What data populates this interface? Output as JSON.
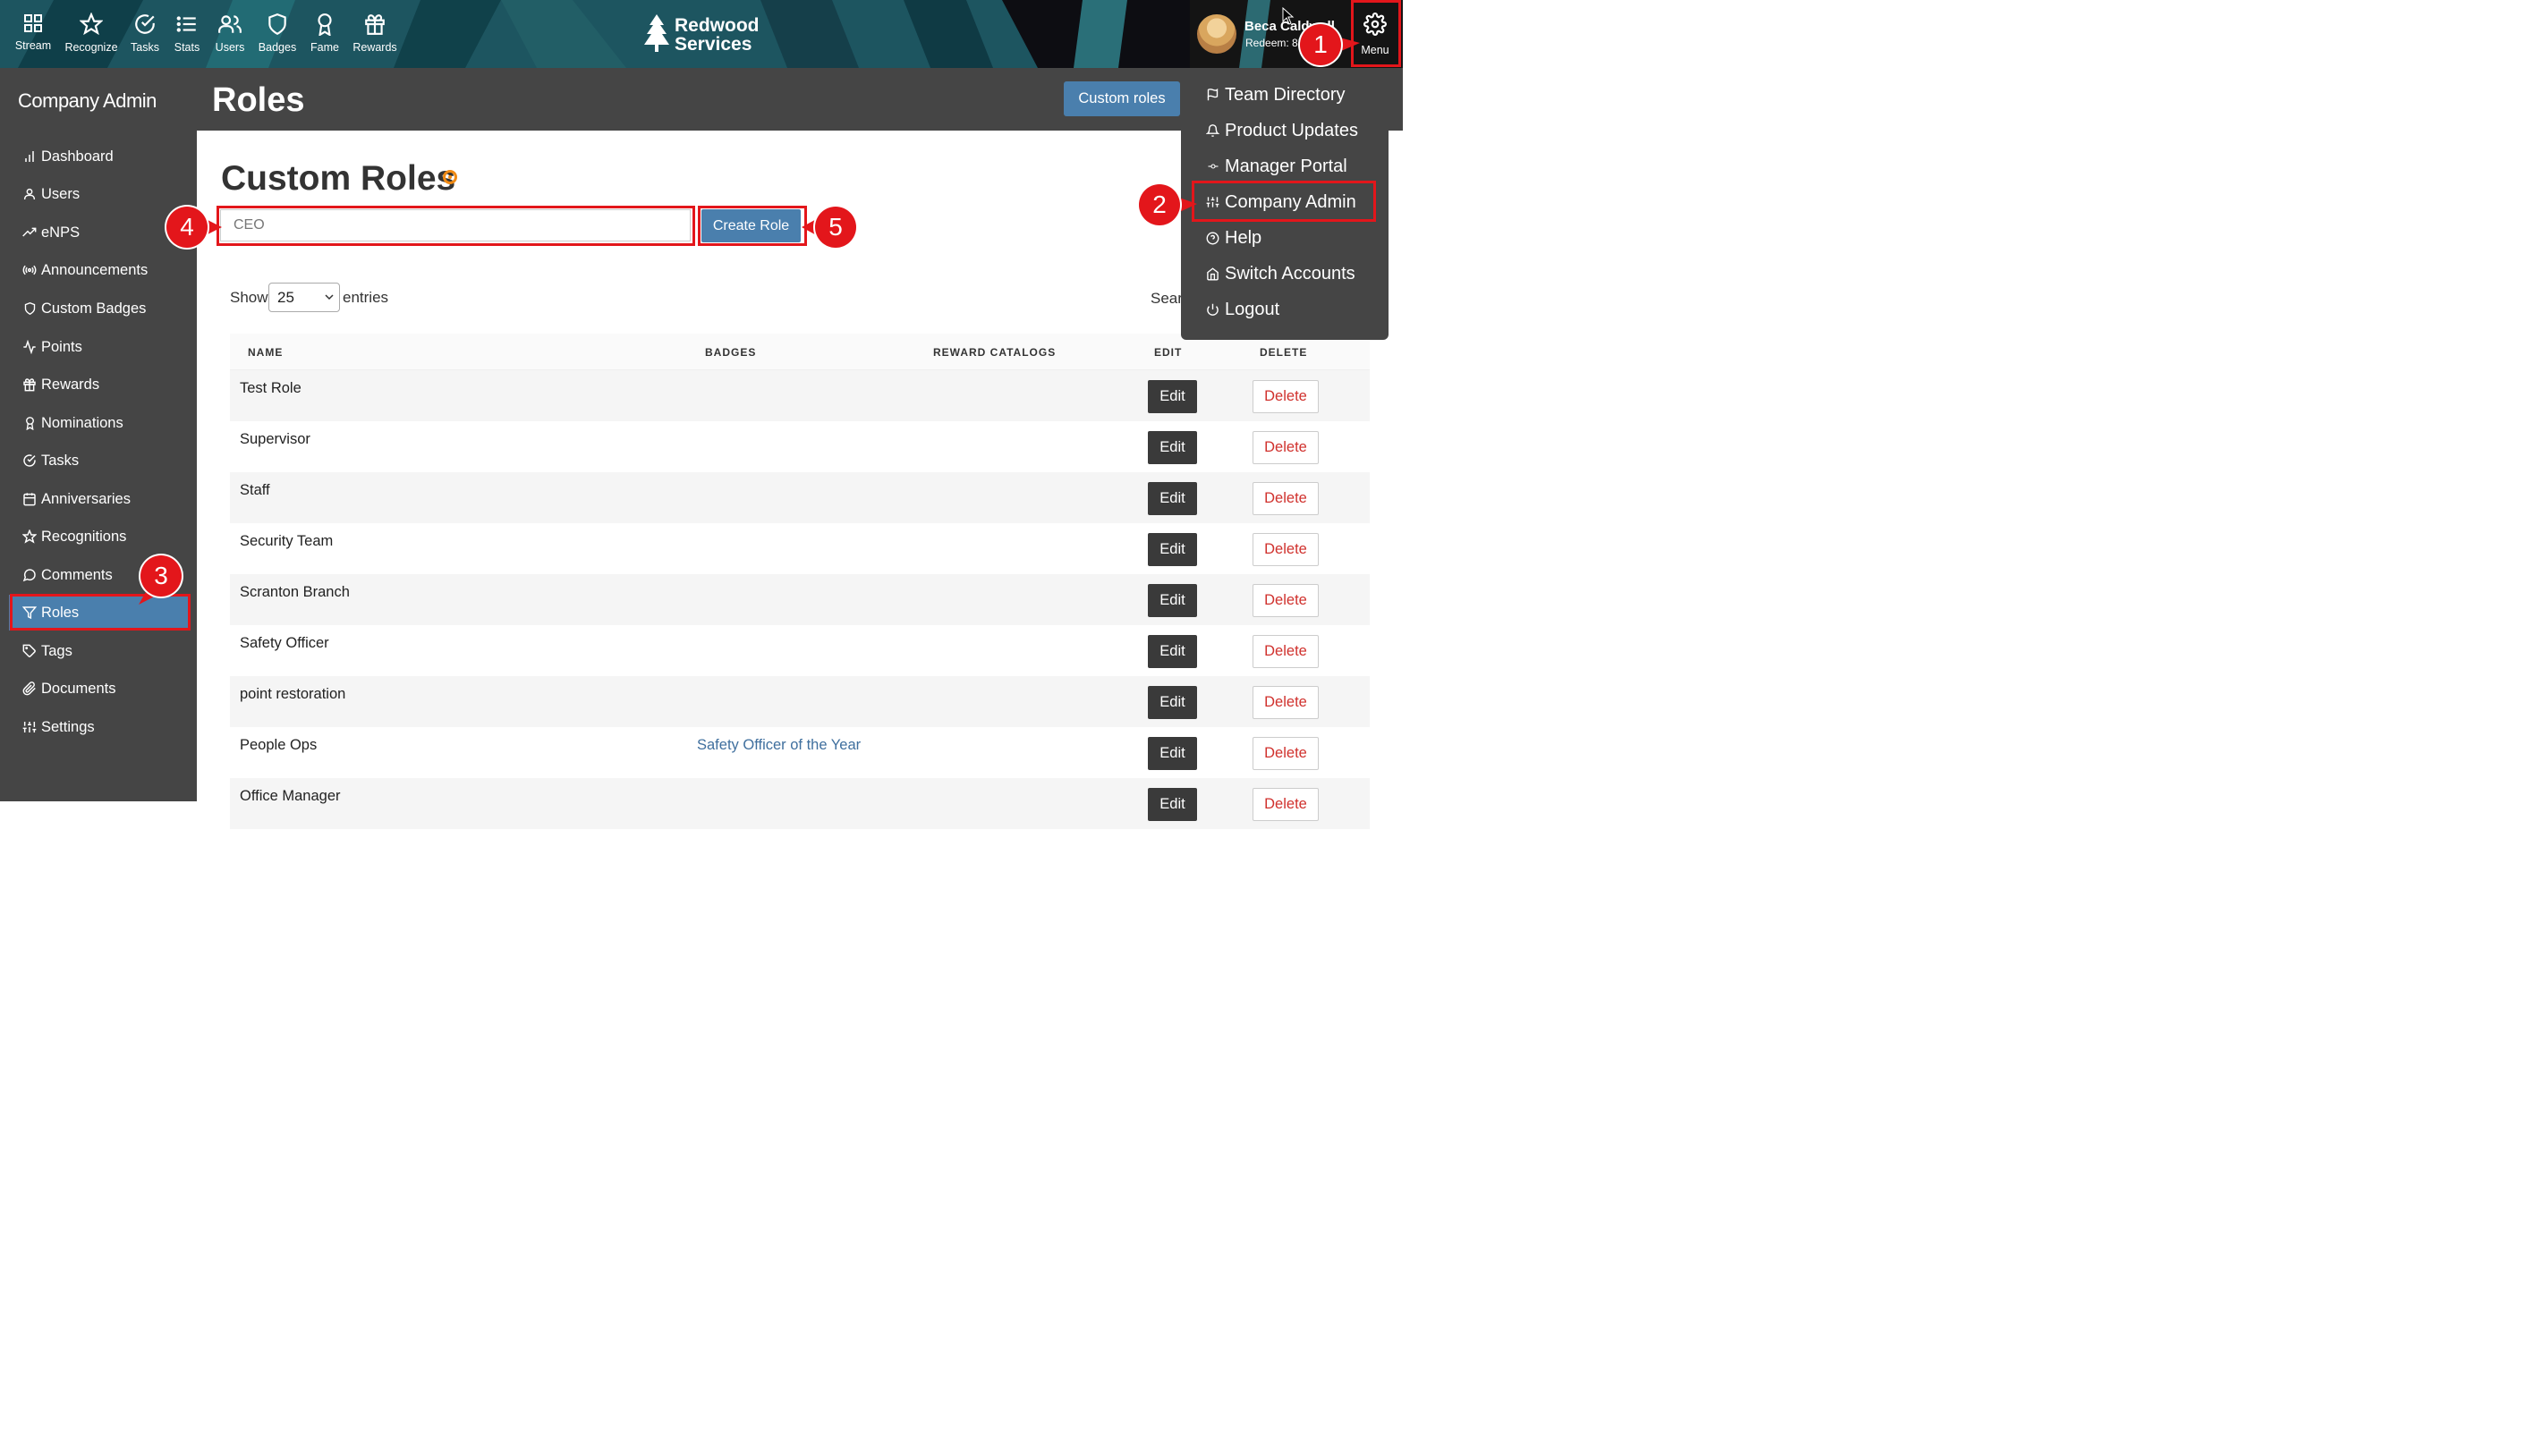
{
  "topnav": {
    "items": [
      {
        "label": "Stream",
        "icon": "grid-icon"
      },
      {
        "label": "Recognize",
        "icon": "star-icon"
      },
      {
        "label": "Tasks",
        "icon": "check-circle-icon"
      },
      {
        "label": "Stats",
        "icon": "list-icon"
      },
      {
        "label": "Users",
        "icon": "users-icon"
      },
      {
        "label": "Badges",
        "icon": "shield-icon"
      },
      {
        "label": "Fame",
        "icon": "award-icon"
      },
      {
        "label": "Rewards",
        "icon": "gift-icon"
      }
    ],
    "brand_line1": "Redwood",
    "brand_line2": "Services",
    "user_name": "Beca Caldwell",
    "user_redeem": "Redeem: 85",
    "menu_label": "Menu"
  },
  "sidebar": {
    "title": "Company Admin",
    "items": [
      {
        "label": "Dashboard",
        "icon": "bar-chart-icon"
      },
      {
        "label": "Users",
        "icon": "user-icon"
      },
      {
        "label": "eNPS",
        "icon": "trending-up-icon"
      },
      {
        "label": "Announcements",
        "icon": "broadcast-icon"
      },
      {
        "label": "Custom Badges",
        "icon": "shield-icon"
      },
      {
        "label": "Points",
        "icon": "activity-icon"
      },
      {
        "label": "Rewards",
        "icon": "gift-icon"
      },
      {
        "label": "Nominations",
        "icon": "award-icon"
      },
      {
        "label": "Tasks",
        "icon": "check-circle-icon"
      },
      {
        "label": "Anniversaries",
        "icon": "calendar-icon"
      },
      {
        "label": "Recognitions",
        "icon": "star-icon"
      },
      {
        "label": "Comments",
        "icon": "message-circle-icon"
      },
      {
        "label": "Roles",
        "icon": "filter-icon",
        "active": true
      },
      {
        "label": "Tags",
        "icon": "tag-icon"
      },
      {
        "label": "Documents",
        "icon": "paperclip-icon"
      },
      {
        "label": "Settings",
        "icon": "sliders-icon"
      }
    ]
  },
  "header": {
    "title": "Roles",
    "custom_roles_button": "Custom roles"
  },
  "main": {
    "section_title": "Custom Roles",
    "role_input_value": "CEO",
    "create_button": "Create Role",
    "show_label": "Show",
    "entries_value": "25",
    "entries_label": "entries",
    "search_label": "Sear"
  },
  "table": {
    "columns": [
      "NAME",
      "BADGES",
      "REWARD CATALOGS",
      "EDIT",
      "DELETE"
    ],
    "edit_label": "Edit",
    "delete_label": "Delete",
    "rows": [
      {
        "name": "Test Role",
        "badges": ""
      },
      {
        "name": "Supervisor",
        "badges": ""
      },
      {
        "name": "Staff",
        "badges": ""
      },
      {
        "name": "Security Team",
        "badges": ""
      },
      {
        "name": "Scranton Branch",
        "badges": ""
      },
      {
        "name": "Safety Officer",
        "badges": ""
      },
      {
        "name": "point restoration",
        "badges": ""
      },
      {
        "name": "People Ops",
        "badges": "Safety Officer of the Year"
      },
      {
        "name": "Office Manager",
        "badges": ""
      }
    ]
  },
  "dropdown": {
    "items": [
      {
        "label": "Team Directory",
        "icon": "flag-icon"
      },
      {
        "label": "Product Updates",
        "icon": "bell-icon"
      },
      {
        "label": "Manager Portal",
        "icon": "git-commit-icon"
      },
      {
        "label": "Company Admin",
        "icon": "sliders-icon"
      },
      {
        "label": "Help",
        "icon": "help-circle-icon"
      },
      {
        "label": "Switch Accounts",
        "icon": "home-icon"
      },
      {
        "label": "Logout",
        "icon": "power-icon"
      }
    ]
  },
  "annotations": [
    "1",
    "2",
    "3",
    "4",
    "5"
  ],
  "colors": {
    "accent": "#4a7fad",
    "sidebar_bg": "#454545",
    "annotation_red": "#e3161b",
    "delete_red": "#d0312d",
    "topbar_bg": "#1e5a64"
  }
}
